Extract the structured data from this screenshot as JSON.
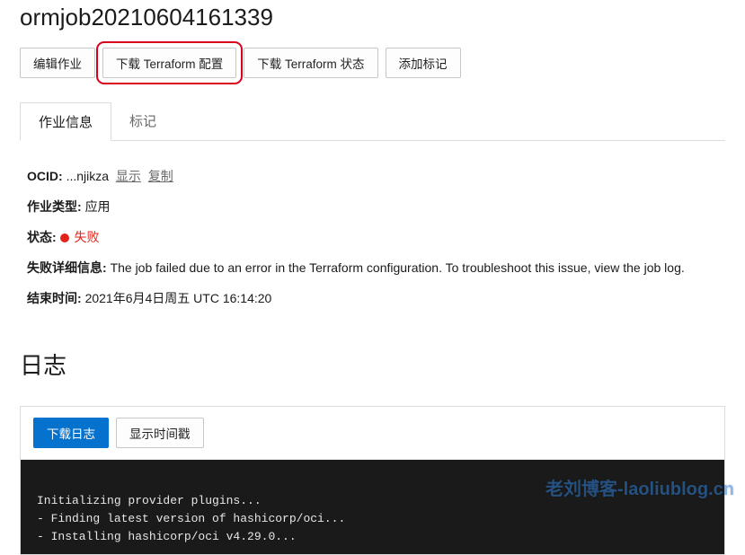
{
  "header": {
    "title": "ormjob20210604161339"
  },
  "buttons": {
    "edit": "编辑作业",
    "download_config": "下载 Terraform 配置",
    "download_state": "下载 Terraform 状态",
    "add_tag": "添加标记"
  },
  "tabs": {
    "job_info": "作业信息",
    "tags": "标记"
  },
  "info": {
    "ocid_label": "OCID:",
    "ocid_value": "...njikza",
    "show": "显示",
    "copy": "复制",
    "type_label": "作业类型:",
    "type_value": "应用",
    "state_label": "状态:",
    "state_value": "失败",
    "fail_label": "失败详细信息:",
    "fail_value": "The job failed due to an error in the Terraform configuration. To troubleshoot this issue, view the job log.",
    "end_label": "结束时间:",
    "end_value": "2021年6月4日周五 UTC 16:14:20"
  },
  "logs": {
    "section_title": "日志",
    "download": "下载日志",
    "show_ts": "显示时间戳",
    "lines": [
      "Initializing provider plugins...",
      "- Finding latest version of hashicorp/oci...",
      "- Installing hashicorp/oci v4.29.0..."
    ]
  },
  "watermark": "老刘博客-laoliublog.cn"
}
